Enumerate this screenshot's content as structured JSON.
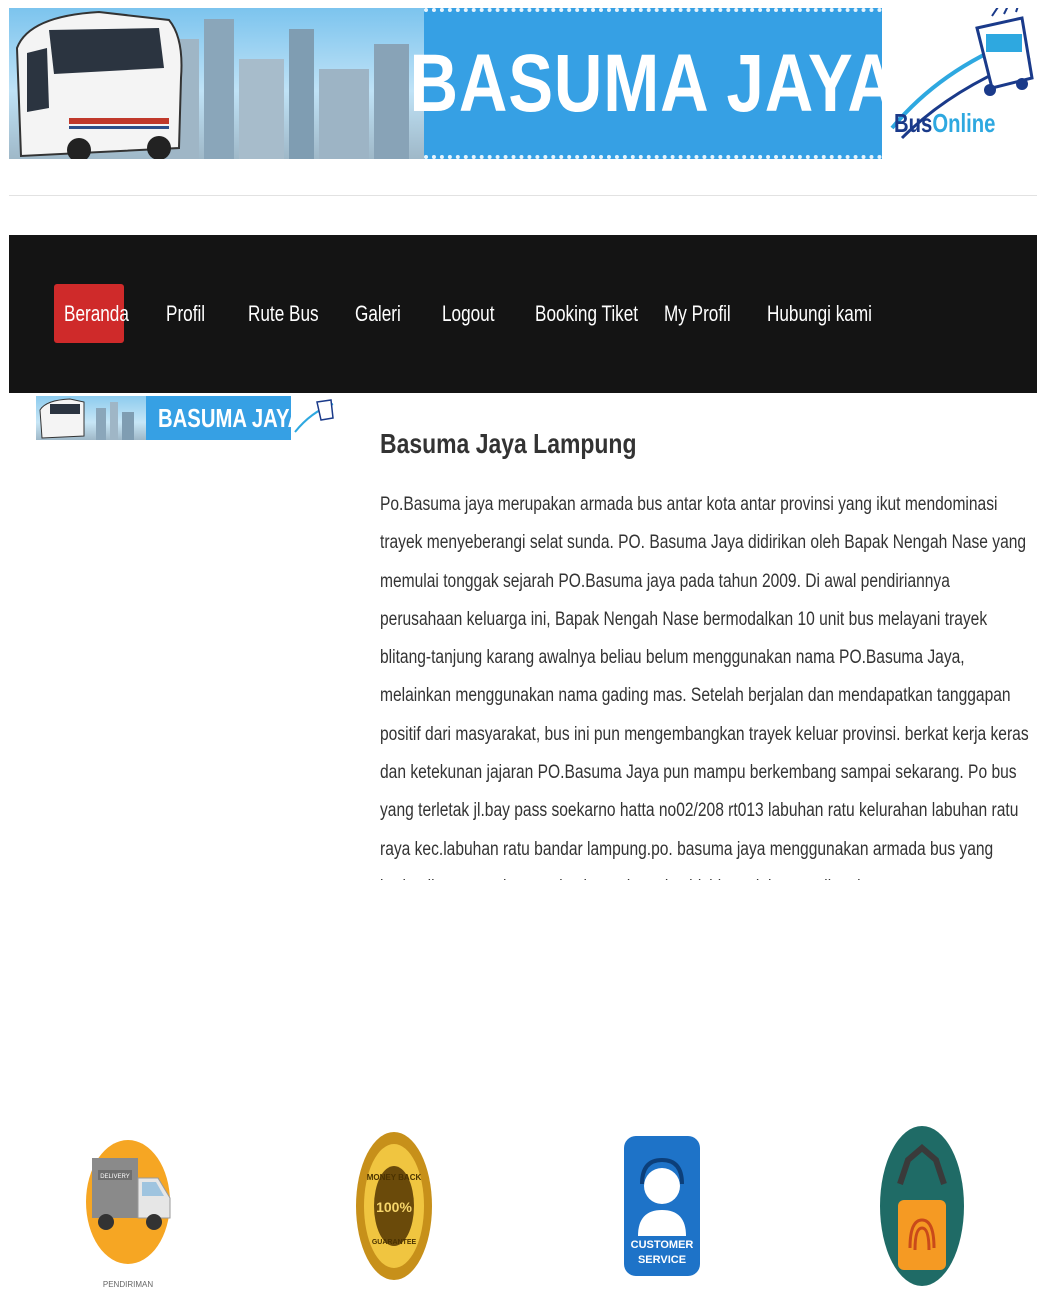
{
  "header": {
    "title": "BASUMA JAYA",
    "logo": {
      "part1": "Bus",
      "part2": "Online"
    }
  },
  "nav": {
    "items": [
      {
        "label": "Beranda",
        "active": true
      },
      {
        "label": "Profil"
      },
      {
        "label": "Rute Bus"
      },
      {
        "label": "Galeri"
      },
      {
        "label": "Logout"
      },
      {
        "label": "Booking Tiket"
      },
      {
        "label": "My Profil"
      },
      {
        "label": "Hubungi kami"
      }
    ]
  },
  "sidebar": {
    "mini_banner_title": "BASUMA JAYA"
  },
  "article": {
    "title": "Basuma Jaya Lampung",
    "body": "Po.Basuma jaya merupakan armada bus antar kota antar provinsi yang ikut mendominasi trayek menyeberangi selat sunda. PO. Basuma Jaya didirikan oleh Bapak Nengah Nase yang memulai tonggak sejarah PO.Basuma jaya pada tahun 2009. Di awal pendiriannya perusahaan keluarga ini, Bapak Nengah Nase bermodalkan 10 unit bus melayani trayek blitang-tanjung karang awalnya beliau belum menggunakan nama PO.Basuma Jaya, melainkan menggunakan nama gading mas. Setelah berjalan dan mendapatkan tanggapan positif dari masyarakat, bus ini pun mengembangkan trayek keluar provinsi. berkat kerja keras dan ketekunan jajaran PO.Basuma Jaya pun mampu berkembang sampai sekarang. Po bus yang terletak jl.bay pass soekarno hatta no02/208 rt013 labuhan ratu kelurahan labuhan ratu raya kec.labuhan ratu bandar lampung.po. basuma jaya menggunakan armada bus yang berkualitas seperti mercedes benz dan mitsubishi untuk bus medium.kenyamanan penumpang hal yang utama di PO.Basuma jaya"
  },
  "features": [
    {
      "icon": "delivery-truck-icon",
      "caption": "PENDIRIMAN",
      "truck_label": "DELIVERY",
      "color": "#f6a623"
    },
    {
      "icon": "money-back-guarantee-icon",
      "badge_top": "MONEY BACK",
      "badge_mid": "100%",
      "badge_bottom": "GUARANTEE",
      "color": "#e0a81c"
    },
    {
      "icon": "customer-service-icon",
      "line1": "CUSTOMER",
      "line2": "SERVICE",
      "color": "#1e73c8"
    },
    {
      "icon": "padlock-fingerprint-icon",
      "color": "#1f6b66"
    }
  ]
}
